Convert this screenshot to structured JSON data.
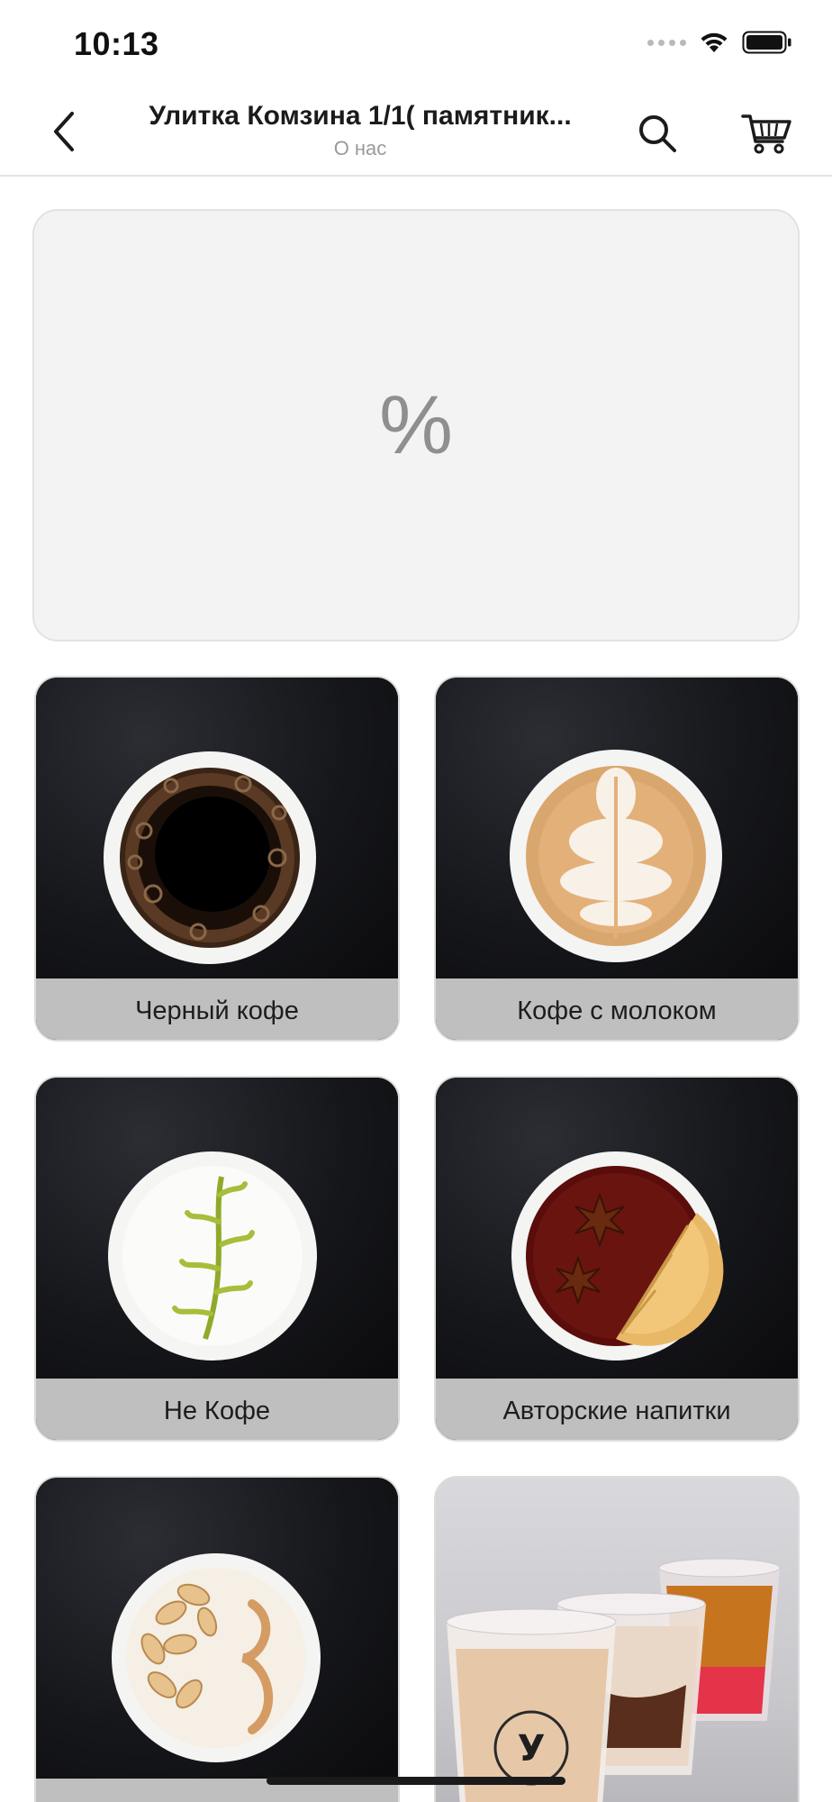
{
  "status_bar": {
    "time": "10:13",
    "icons": [
      "signal-dots-icon",
      "wifi-icon",
      "battery-icon"
    ]
  },
  "nav": {
    "title": "Улитка  Комзина 1/1( памятник...",
    "subtitle": "О нас",
    "icons": [
      "back-chevron-icon",
      "search-icon",
      "cart-icon"
    ]
  },
  "promo": {
    "symbol": "%"
  },
  "categories": [
    {
      "label": "Черный кофе",
      "icon": "black-coffee-cup"
    },
    {
      "label": "Кофе с молоком",
      "icon": "latte-art-cup"
    },
    {
      "label": "Не Кофе",
      "icon": "matcha-latte-cup"
    },
    {
      "label": "Авторские напитки",
      "icon": "tea-star-anise-cup"
    },
    {
      "label": "",
      "icon": "almond-latte-cup"
    },
    {
      "label": "",
      "icon": "iced-drinks-cups"
    }
  ],
  "colors": {
    "caption_bg": "#bfbfbf",
    "banner_bg": "#f3f3f3",
    "promo_symbol": "#8f8f8f",
    "subtitle": "#9a9a9a"
  }
}
